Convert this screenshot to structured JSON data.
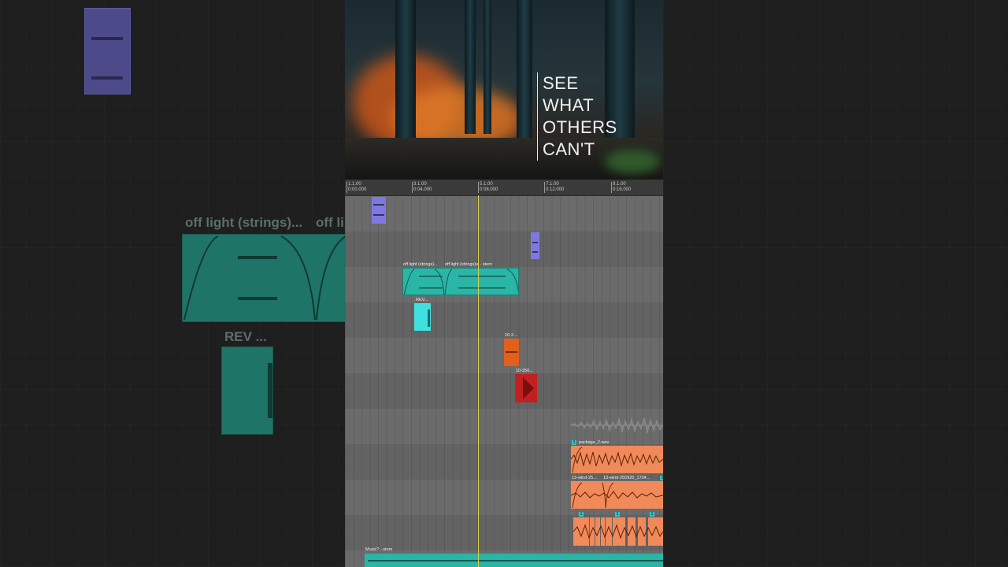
{
  "poster": {
    "tagline_lines": [
      "SEE",
      "WHAT",
      "OTHERS",
      "CAN'T"
    ]
  },
  "ruler": {
    "markers": [
      {
        "bar": "1.1.00",
        "time": "0:00.000"
      },
      {
        "bar": "3.1.00",
        "time": "0:04.000"
      },
      {
        "bar": "5.1.00",
        "time": "0:08.000"
      },
      {
        "bar": "7.1.00",
        "time": "0:12.000"
      },
      {
        "bar": "9.1.00",
        "time": "0:16.000"
      }
    ]
  },
  "clips": {
    "strings_a": "off light (strings)...",
    "strings_b": "off light (strings)w - stem",
    "rev": "REV...",
    "c10a": "10-2...",
    "c10b": "10-250...",
    "package": "package_2.wav",
    "wind_a": "13-wind-25...",
    "wind_b": "13-wind-250920_1734...",
    "music": "Music? - stem"
  },
  "badges": {
    "package": "1",
    "wind": "1",
    "chop_a": "1",
    "chop_b": "1",
    "chop_c": "1"
  },
  "zoom": {
    "strings_label": "off light (strings)...",
    "strings_label_2": "off li",
    "rev_label": "REV ..."
  },
  "colors": {
    "purple_clip": "#7e79e0",
    "teal_clip": "#2bb5a6",
    "cyan_clip": "#3fe0e0",
    "orange_clip": "#e0601c",
    "red_clip": "#c22020",
    "salmon_clip": "#f08a5a",
    "playhead": "#d8d24a"
  }
}
